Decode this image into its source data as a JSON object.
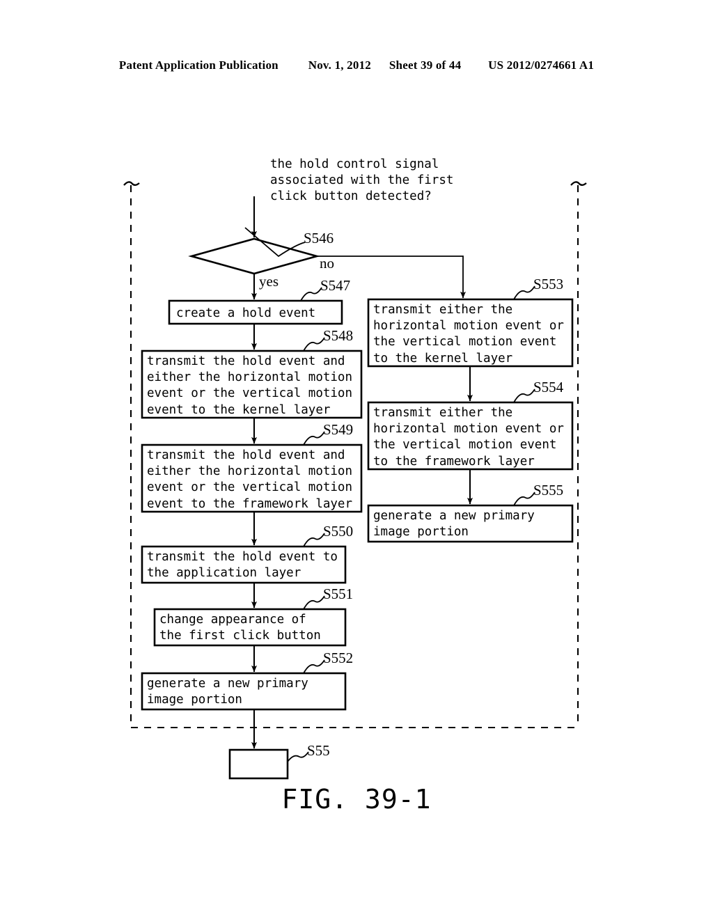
{
  "header": {
    "publication": "Patent Application Publication",
    "date": "Nov. 1, 2012",
    "sheet": "Sheet 39 of 44",
    "patent_number": "US 2012/0274661 A1"
  },
  "figure": {
    "caption": "FIG. 39-1",
    "question": "the hold control signal\nassociated with the first\nclick button detected?",
    "branch_yes": "yes",
    "branch_no": "no",
    "decision_ref": "S546"
  },
  "steps": [
    {
      "ref": "S547",
      "text": "create a hold event"
    },
    {
      "ref": "S548",
      "text": "transmit the hold event and\neither the horizontal motion\nevent or the vertical motion\nevent to the kernel layer"
    },
    {
      "ref": "S549",
      "text": "transmit the hold event and\neither the horizontal motion\nevent or the vertical motion\nevent to the framework layer"
    },
    {
      "ref": "S550",
      "text": "transmit the hold event to\nthe application layer"
    },
    {
      "ref": "S551",
      "text": "change appearance of\nthe first click button"
    },
    {
      "ref": "S552",
      "text": "generate a new primary\nimage portion"
    },
    {
      "ref": "S553",
      "text": "transmit either the\nhorizontal motion event or\nthe vertical motion event\nto the kernel layer"
    },
    {
      "ref": "S554",
      "text": "transmit either the\nhorizontal motion event or\nthe vertical motion event\nto the framework layer"
    },
    {
      "ref": "S555",
      "text": "generate a new primary\nimage portion"
    },
    {
      "ref": "S55",
      "text": ""
    }
  ]
}
